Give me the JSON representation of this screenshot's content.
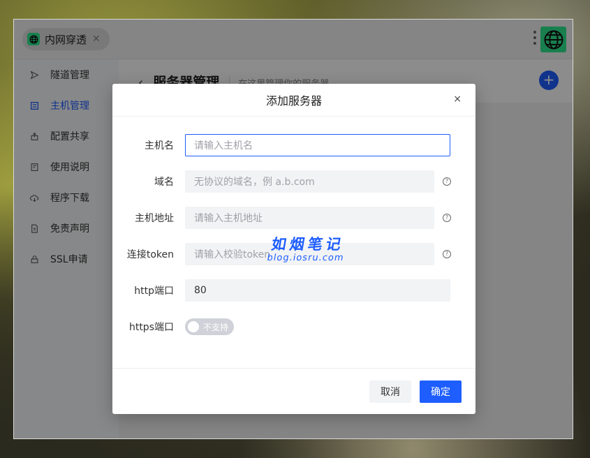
{
  "titlebar": {
    "tab_label": "内网穿透",
    "tab_close": "✕"
  },
  "sidebar": {
    "items": [
      {
        "label": "隧道管理",
        "icon": "send-icon",
        "active": false
      },
      {
        "label": "主机管理",
        "icon": "list-icon",
        "active": true
      },
      {
        "label": "配置共享",
        "icon": "share-icon",
        "active": false
      },
      {
        "label": "使用说明",
        "icon": "book-icon",
        "active": false
      },
      {
        "label": "程序下载",
        "icon": "cloud-download-icon",
        "active": false
      },
      {
        "label": "免责声明",
        "icon": "document-icon",
        "active": false
      },
      {
        "label": "SSL申请",
        "icon": "lock-icon",
        "active": false
      }
    ]
  },
  "page": {
    "back_glyph": "‹",
    "title": "服务器管理",
    "subtitle": "在这里管理你的服务器",
    "add_glyph": "+"
  },
  "dialog": {
    "title": "添加服务器",
    "close_glyph": "×",
    "fields": {
      "hostname": {
        "label": "主机名",
        "placeholder": "请输入主机名"
      },
      "domain": {
        "label": "域名",
        "placeholder": "无协议的域名，例 a.b.com"
      },
      "host_addr": {
        "label": "主机地址",
        "placeholder": "请输入主机地址"
      },
      "token": {
        "label": "连接token",
        "placeholder": "请输入校验token"
      },
      "http_port": {
        "label": "http端口",
        "value": "80"
      },
      "https_port": {
        "label": "https端口",
        "toggle_text": "不支持",
        "enabled": false
      }
    },
    "help_glyph": "?",
    "cancel_label": "取消",
    "ok_label": "确定"
  },
  "watermark": {
    "line1": "如烟笔记",
    "line2": "blog.iosru.com"
  },
  "colors": {
    "accent": "#1e5eff",
    "app_icon": "#2ee88f"
  }
}
